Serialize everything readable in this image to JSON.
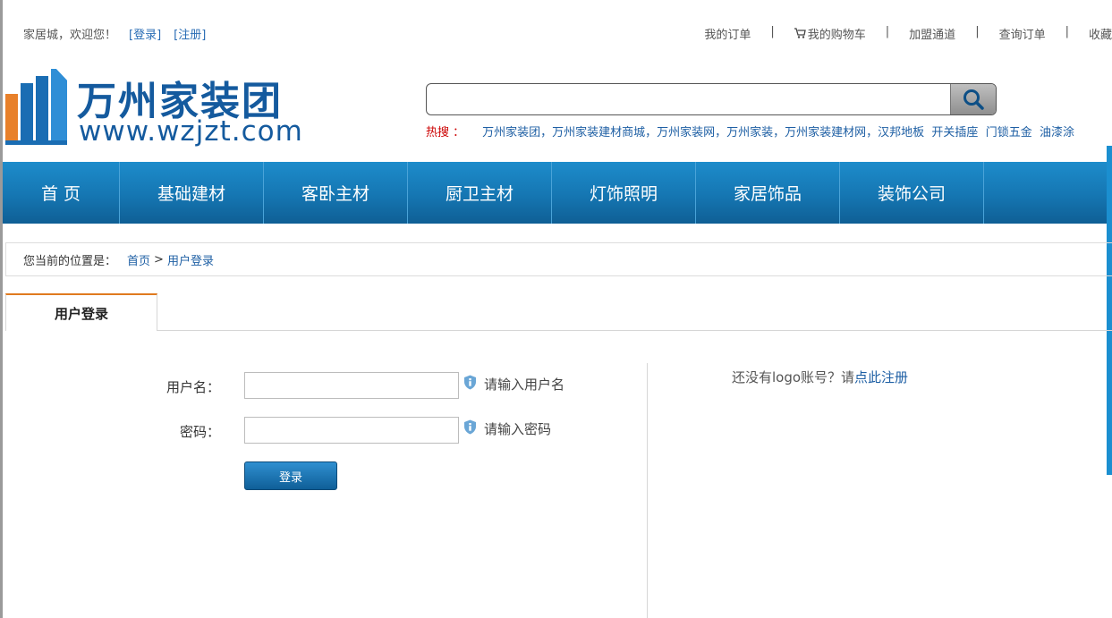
{
  "topbar": {
    "welcome": "家居城，欢迎您！",
    "login_link": "[登录]",
    "register_link": "[注册]",
    "links": [
      "我的订单",
      "我的购物车",
      "加盟通道",
      "查询订单",
      "收藏"
    ],
    "separator": "|"
  },
  "logo": {
    "cn": "万州家装团",
    "url": "www.wzjzt.com",
    "icon": "building-bars-logo"
  },
  "search": {
    "placeholder": "",
    "button_icon": "search-icon",
    "hot_label": "热搜 ：",
    "hot_keywords": "万州家装团，万州家装建材商城，万州家装网，万州家装，万州家装建材网，汉邦地板",
    "hot_extra": [
      "开关插座",
      "门锁五金",
      "油漆涂"
    ]
  },
  "nav": {
    "items": [
      "首 页",
      "基础建材",
      "客卧主材",
      "厨卫主材",
      "灯饰照明",
      "家居饰品",
      "装饰公司"
    ]
  },
  "breadcrumb": {
    "label": "您当前的位置是：",
    "home": "首页",
    "separator": ">",
    "current": "用户登录"
  },
  "login_tab": {
    "label": "用户登录"
  },
  "form": {
    "username_label": "用户名：",
    "username_hint": "请输入用户名",
    "password_label": "密码：",
    "password_hint": "请输入密码",
    "submit_label": "登录"
  },
  "register_note": {
    "text": "还没有logo账号？请",
    "link": "点此注册"
  },
  "colors": {
    "nav": "#1576b2",
    "accent_tab": "#e07a1f",
    "link": "#1e5fa4",
    "hot_label": "#cc0000"
  }
}
